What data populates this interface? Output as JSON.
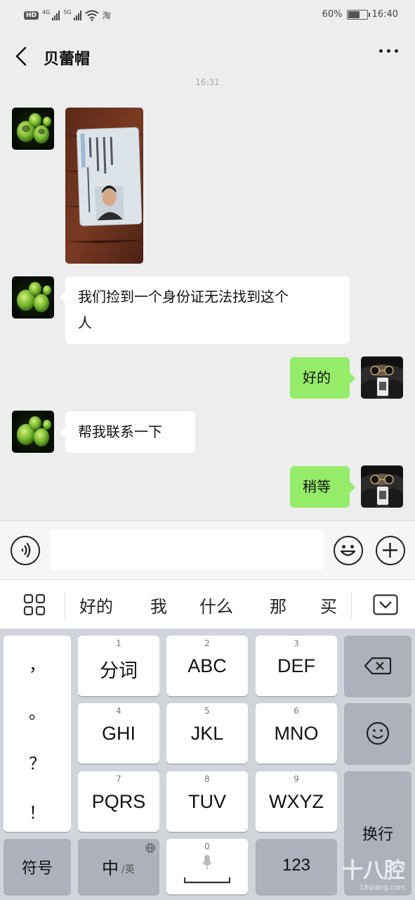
{
  "status_bar": {
    "network_hd": "HD",
    "sim1": "4G",
    "sim2": "5G",
    "app_tag": "淘",
    "battery_percent": "60%",
    "battery_level": 0.6,
    "time": "16:40"
  },
  "header": {
    "back_icon": "chevron-left-icon",
    "title": "贝蕾帽",
    "more_icon": "more-dots-icon"
  },
  "timestamp": "16:31",
  "messages": [
    {
      "direction": "in",
      "type": "image",
      "content": "id-card-photo"
    },
    {
      "direction": "in",
      "type": "text",
      "line1": "我们捡到一个身份证无法找到这个",
      "line2": "人"
    },
    {
      "direction": "out",
      "type": "text",
      "text": "好的"
    },
    {
      "direction": "in",
      "type": "text",
      "text": "帮我联系一下"
    },
    {
      "direction": "out",
      "type": "text",
      "text": "稍等"
    }
  ],
  "input_bar": {
    "voice_icon": "voice-icon",
    "emoji_icon": "emoji-icon",
    "plus_icon": "plus-icon",
    "value": ""
  },
  "candidates": {
    "menu_icon": "grid-icon",
    "items": [
      "好的",
      "我",
      "什么",
      "那",
      "买"
    ],
    "collapse_icon": "keyboard-down-icon"
  },
  "keyboard": {
    "punctuation": [
      "，",
      "。",
      "？",
      "！"
    ],
    "keys": [
      {
        "num": "1",
        "label": "分词"
      },
      {
        "num": "2",
        "label": "ABC"
      },
      {
        "num": "3",
        "label": "DEF"
      },
      {
        "num": "4",
        "label": "GHI"
      },
      {
        "num": "5",
        "label": "JKL"
      },
      {
        "num": "6",
        "label": "MNO"
      },
      {
        "num": "7",
        "label": "PQRS"
      },
      {
        "num": "8",
        "label": "TUV"
      },
      {
        "num": "9",
        "label": "WXYZ"
      }
    ],
    "backspace_icon": "backspace-icon",
    "emoji_key_icon": "smiley-icon",
    "enter_label": "换行",
    "symbol_label": "符号",
    "lang_label": "中",
    "lang_sub": "/英",
    "globe_icon": "globe-icon",
    "space_num": "0",
    "mic_icon": "mic-icon",
    "num_label": "123"
  },
  "watermark": {
    "text": "十八腔",
    "url": "18qiang.com"
  },
  "colors": {
    "bubble_out": "#95ec69",
    "bubble_in": "#ffffff",
    "background": "#ededed",
    "keyboard": "#d2d4db"
  }
}
